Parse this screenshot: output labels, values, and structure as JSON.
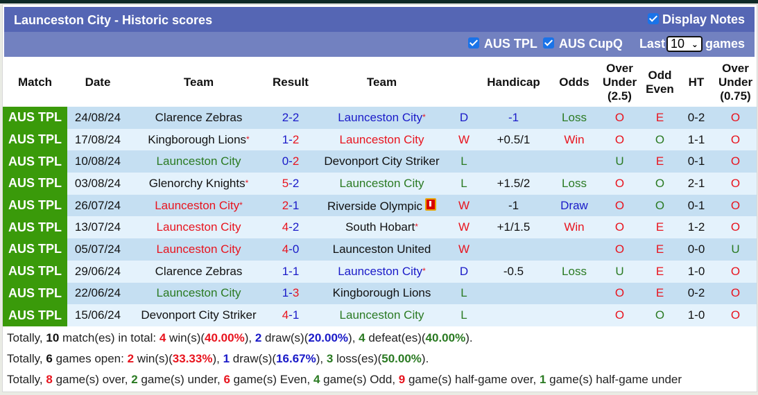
{
  "header": {
    "title": "Launceston City - Historic scores",
    "display_notes_label": "Display Notes",
    "display_notes_checked": true
  },
  "filters": {
    "items": [
      {
        "label": "AUS TPL",
        "checked": true
      },
      {
        "label": "AUS CupQ",
        "checked": true
      }
    ],
    "last_label": "Last",
    "last_value": "10",
    "games_label": "games"
  },
  "columns": [
    "Match",
    "Date",
    "Team",
    "Result",
    "Team",
    "",
    "Handicap",
    "Odds",
    "Over Under (2.5)",
    "Odd Even",
    "HT",
    "Over Under (0.75)"
  ],
  "column_lines": {
    "ou25": [
      "Over",
      "Under",
      "(2.5)"
    ],
    "oe": [
      "Odd",
      "Even"
    ],
    "ou075": [
      "Over",
      "Under",
      "(0.75)"
    ]
  },
  "colors": {
    "league_bg": "#3a9a0a",
    "header_bg": "#5566b4",
    "filter_bg": "#7281c0",
    "row_odd": "#c5dff2",
    "row_even": "#e4f2fc",
    "red": "#e8141e",
    "blue": "#1a1ac8",
    "green": "#2a7a22"
  },
  "rows": [
    {
      "league": "AUS TPL",
      "date": "24/08/24",
      "home": "Clarence Zebras",
      "home_color": "black",
      "home_star": false,
      "score_home": "2",
      "score_home_color": "blue",
      "score_away": "2",
      "score_away_color": "blue",
      "away": "Launceston City",
      "away_color": "blue",
      "away_star": true,
      "away_redcard": false,
      "wl": "D",
      "wl_color": "blue",
      "handicap": "-1",
      "handicap_color": "blue",
      "odds": "Loss",
      "odds_color": "green",
      "ou": "O",
      "ou_color": "red",
      "oe": "E",
      "oe_color": "red",
      "ht": "0-2",
      "ou2": "O",
      "ou2_color": "red"
    },
    {
      "league": "AUS TPL",
      "date": "17/08/24",
      "home": "Kingborough Lions",
      "home_color": "black",
      "home_star": true,
      "score_home": "1",
      "score_home_color": "blue",
      "score_away": "2",
      "score_away_color": "red",
      "away": "Launceston City",
      "away_color": "red",
      "away_star": false,
      "away_redcard": false,
      "wl": "W",
      "wl_color": "red",
      "handicap": "+0.5/1",
      "handicap_color": "black",
      "odds": "Win",
      "odds_color": "red",
      "ou": "O",
      "ou_color": "red",
      "oe": "O",
      "oe_color": "green",
      "ht": "1-1",
      "ou2": "O",
      "ou2_color": "red"
    },
    {
      "league": "AUS TPL",
      "date": "10/08/24",
      "home": "Launceston City",
      "home_color": "green",
      "home_star": false,
      "score_home": "0",
      "score_home_color": "blue",
      "score_away": "2",
      "score_away_color": "red",
      "away": "Devonport City Striker",
      "away_color": "black",
      "away_star": false,
      "away_redcard": false,
      "wl": "L",
      "wl_color": "green",
      "handicap": "",
      "handicap_color": "black",
      "odds": "",
      "odds_color": "black",
      "ou": "U",
      "ou_color": "green",
      "oe": "E",
      "oe_color": "red",
      "ht": "0-1",
      "ou2": "O",
      "ou2_color": "red"
    },
    {
      "league": "AUS TPL",
      "date": "03/08/24",
      "home": "Glenorchy Knights",
      "home_color": "black",
      "home_star": true,
      "score_home": "5",
      "score_home_color": "red",
      "score_away": "2",
      "score_away_color": "blue",
      "away": "Launceston City",
      "away_color": "green",
      "away_star": false,
      "away_redcard": false,
      "wl": "L",
      "wl_color": "green",
      "handicap": "+1.5/2",
      "handicap_color": "black",
      "odds": "Loss",
      "odds_color": "green",
      "ou": "O",
      "ou_color": "red",
      "oe": "O",
      "oe_color": "green",
      "ht": "2-1",
      "ou2": "O",
      "ou2_color": "red"
    },
    {
      "league": "AUS TPL",
      "date": "26/07/24",
      "home": "Launceston City",
      "home_color": "red",
      "home_star": true,
      "score_home": "2",
      "score_home_color": "red",
      "score_away": "1",
      "score_away_color": "blue",
      "away": "Riverside Olympic",
      "away_color": "black",
      "away_star": false,
      "away_redcard": true,
      "wl": "W",
      "wl_color": "red",
      "handicap": "-1",
      "handicap_color": "black",
      "odds": "Draw",
      "odds_color": "blue",
      "ou": "O",
      "ou_color": "red",
      "oe": "O",
      "oe_color": "green",
      "ht": "0-1",
      "ou2": "O",
      "ou2_color": "red"
    },
    {
      "league": "AUS TPL",
      "date": "13/07/24",
      "home": "Launceston City",
      "home_color": "red",
      "home_star": false,
      "score_home": "4",
      "score_home_color": "red",
      "score_away": "2",
      "score_away_color": "blue",
      "away": "South Hobart",
      "away_color": "black",
      "away_star": true,
      "away_redcard": false,
      "wl": "W",
      "wl_color": "red",
      "handicap": "+1/1.5",
      "handicap_color": "black",
      "odds": "Win",
      "odds_color": "red",
      "ou": "O",
      "ou_color": "red",
      "oe": "E",
      "oe_color": "red",
      "ht": "1-2",
      "ou2": "O",
      "ou2_color": "red"
    },
    {
      "league": "AUS TPL",
      "date": "05/07/24",
      "home": "Launceston City",
      "home_color": "red",
      "home_star": false,
      "score_home": "4",
      "score_home_color": "red",
      "score_away": "0",
      "score_away_color": "blue",
      "away": "Launceston United",
      "away_color": "black",
      "away_star": false,
      "away_redcard": false,
      "wl": "W",
      "wl_color": "red",
      "handicap": "",
      "handicap_color": "black",
      "odds": "",
      "odds_color": "black",
      "ou": "O",
      "ou_color": "red",
      "oe": "E",
      "oe_color": "red",
      "ht": "0-0",
      "ou2": "U",
      "ou2_color": "green"
    },
    {
      "league": "AUS TPL",
      "date": "29/06/24",
      "home": "Clarence Zebras",
      "home_color": "black",
      "home_star": false,
      "score_home": "1",
      "score_home_color": "blue",
      "score_away": "1",
      "score_away_color": "blue",
      "away": "Launceston City",
      "away_color": "blue",
      "away_star": true,
      "away_redcard": false,
      "wl": "D",
      "wl_color": "blue",
      "handicap": "-0.5",
      "handicap_color": "black",
      "odds": "Loss",
      "odds_color": "green",
      "ou": "U",
      "ou_color": "green",
      "oe": "E",
      "oe_color": "red",
      "ht": "1-0",
      "ou2": "O",
      "ou2_color": "red"
    },
    {
      "league": "AUS TPL",
      "date": "22/06/24",
      "home": "Launceston City",
      "home_color": "green",
      "home_star": false,
      "score_home": "1",
      "score_home_color": "blue",
      "score_away": "3",
      "score_away_color": "red",
      "away": "Kingborough Lions",
      "away_color": "black",
      "away_star": false,
      "away_redcard": false,
      "wl": "L",
      "wl_color": "green",
      "handicap": "",
      "handicap_color": "black",
      "odds": "",
      "odds_color": "black",
      "ou": "O",
      "ou_color": "red",
      "oe": "E",
      "oe_color": "red",
      "ht": "0-2",
      "ou2": "O",
      "ou2_color": "red"
    },
    {
      "league": "AUS TPL",
      "date": "15/06/24",
      "home": "Devonport City Striker",
      "home_color": "black",
      "home_star": false,
      "score_home": "4",
      "score_home_color": "red",
      "score_away": "1",
      "score_away_color": "blue",
      "away": "Launceston City",
      "away_color": "green",
      "away_star": false,
      "away_redcard": false,
      "wl": "L",
      "wl_color": "green",
      "handicap": "",
      "handicap_color": "black",
      "odds": "",
      "odds_color": "black",
      "ou": "O",
      "ou_color": "red",
      "oe": "O",
      "oe_color": "green",
      "ht": "1-0",
      "ou2": "O",
      "ou2_color": "red"
    }
  ],
  "summary": [
    [
      {
        "t": "Totally, "
      },
      {
        "t": "10",
        "c": "black",
        "b": true
      },
      {
        "t": " match(es) in total: "
      },
      {
        "t": "4",
        "c": "red",
        "b": true
      },
      {
        "t": " win(s)("
      },
      {
        "t": "40.00%",
        "c": "red",
        "b": true
      },
      {
        "t": "), "
      },
      {
        "t": "2",
        "c": "blue",
        "b": true
      },
      {
        "t": " draw(s)("
      },
      {
        "t": "20.00%",
        "c": "blue",
        "b": true
      },
      {
        "t": "), "
      },
      {
        "t": "4",
        "c": "green",
        "b": true
      },
      {
        "t": " defeat(es)("
      },
      {
        "t": "40.00%",
        "c": "green",
        "b": true
      },
      {
        "t": ")."
      }
    ],
    [
      {
        "t": "Totally, "
      },
      {
        "t": "6",
        "c": "black",
        "b": true
      },
      {
        "t": " games open: "
      },
      {
        "t": "2",
        "c": "red",
        "b": true
      },
      {
        "t": " win(s)("
      },
      {
        "t": "33.33%",
        "c": "red",
        "b": true
      },
      {
        "t": "), "
      },
      {
        "t": "1",
        "c": "blue",
        "b": true
      },
      {
        "t": " draw(s)("
      },
      {
        "t": "16.67%",
        "c": "blue",
        "b": true
      },
      {
        "t": "), "
      },
      {
        "t": "3",
        "c": "green",
        "b": true
      },
      {
        "t": " loss(es)("
      },
      {
        "t": "50.00%",
        "c": "green",
        "b": true
      },
      {
        "t": ")."
      }
    ],
    [
      {
        "t": "Totally, "
      },
      {
        "t": "8",
        "c": "red",
        "b": true
      },
      {
        "t": " game(s) over, "
      },
      {
        "t": "2",
        "c": "green",
        "b": true
      },
      {
        "t": " game(s) under, "
      },
      {
        "t": "6",
        "c": "red",
        "b": true
      },
      {
        "t": " game(s) Even, "
      },
      {
        "t": "4",
        "c": "green",
        "b": true
      },
      {
        "t": " game(s) Odd, "
      },
      {
        "t": "9",
        "c": "red",
        "b": true
      },
      {
        "t": " game(s) half-game over, "
      },
      {
        "t": "1",
        "c": "green",
        "b": true
      },
      {
        "t": " game(s) half-game under"
      }
    ]
  ]
}
